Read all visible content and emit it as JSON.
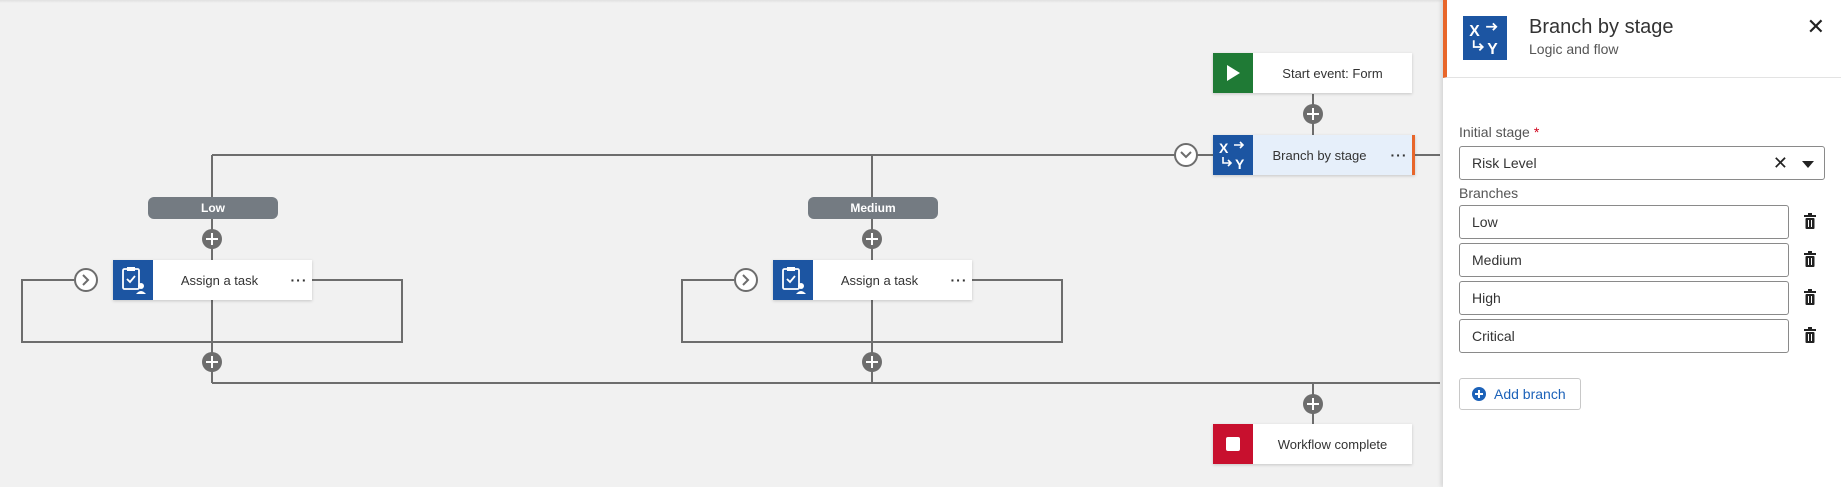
{
  "canvas": {
    "start_node": "Start event: Form",
    "branch_node": "Branch by stage",
    "branches": [
      {
        "pill": "Low",
        "task": "Assign a task"
      },
      {
        "pill": "Medium",
        "task": "Assign a task"
      }
    ],
    "end_node": "Workflow complete",
    "more_label": "···"
  },
  "panel": {
    "title": "Branch by stage",
    "subtitle": "Logic and flow",
    "close_label": "✕",
    "initial_stage_label": "Initial stage",
    "required_mark": "*",
    "initial_stage_value": "Risk Level",
    "clear_label": "✕",
    "branches_label": "Branches",
    "branch_values": [
      "Low",
      "Medium",
      "High",
      "Critical"
    ],
    "add_branch_label": "Add branch"
  },
  "colors": {
    "accent": "#e8662a",
    "brand_blue": "#1c55a2",
    "start_green": "#1f7a35",
    "end_red": "#c8102e",
    "link_blue": "#1c62b9"
  },
  "icons": [
    "play-icon",
    "branch-xy-icon",
    "task-icon",
    "stop-icon",
    "plus-icon",
    "chevron-right-icon",
    "chevron-down-icon",
    "close-icon",
    "trash-icon",
    "add-circle-icon"
  ]
}
